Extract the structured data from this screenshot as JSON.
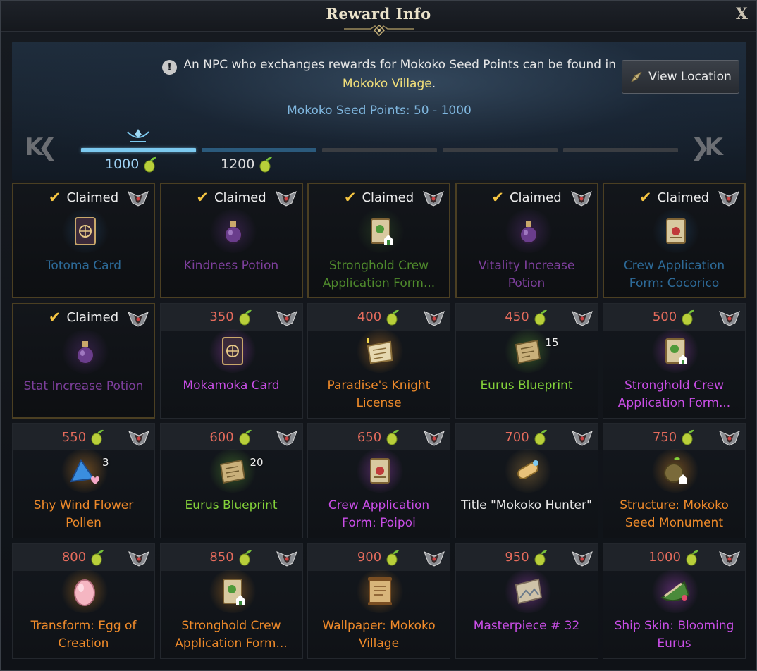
{
  "window": {
    "title": "Reward Info",
    "close_label": "X"
  },
  "header": {
    "notice_text": "An NPC who exchanges rewards for Mokoko Seed Points can be found in",
    "notice_place": "Mokoko Village",
    "notice_end": ".",
    "view_location_label": "View Location",
    "seed_range": "Mokoko Seed Points: 50 - 1000"
  },
  "progress": {
    "left_arrow": "K❮",
    "right_arrow": "❯K",
    "tier_labels": [
      "1000",
      "1200"
    ],
    "active_tier": 0
  },
  "rewards": [
    {
      "status": "Claimed",
      "name": "Totoma Card",
      "color": "dimblue",
      "icon": "card-icon"
    },
    {
      "status": "Claimed",
      "name": "Kindness Potion",
      "color": "dimpurple",
      "icon": "potion-icon"
    },
    {
      "status": "Claimed",
      "name": "Stronghold Crew Application Form...",
      "color": "dimgreen",
      "icon": "scroll-house-icon"
    },
    {
      "status": "Claimed",
      "name": "Vitality Increase Potion",
      "color": "dimpurple",
      "icon": "potion-icon"
    },
    {
      "status": "Claimed",
      "name": "Crew Application Form: Cocorico",
      "color": "dimblue",
      "icon": "scroll-icon"
    },
    {
      "status": "Claimed",
      "name": "Stat Increase Potion",
      "color": "dimpurple",
      "icon": "potion-icon"
    },
    {
      "cost": "350",
      "name": "Mokamoka Card",
      "color": "magenta",
      "icon": "card-icon"
    },
    {
      "cost": "400",
      "name": "Paradise's Knight License",
      "color": "orange",
      "icon": "license-icon"
    },
    {
      "cost": "450",
      "name": "Eurus Blueprint",
      "color": "lime",
      "icon": "blueprint-icon",
      "qty": "15"
    },
    {
      "cost": "500",
      "name": "Stronghold Crew Application Form...",
      "color": "magenta",
      "icon": "scroll-house-icon"
    },
    {
      "cost": "550",
      "name": "Shy Wind Flower Pollen",
      "color": "orange",
      "icon": "pollen-icon",
      "qty": "3"
    },
    {
      "cost": "600",
      "name": "Eurus Blueprint",
      "color": "lime",
      "icon": "blueprint-icon",
      "qty": "20"
    },
    {
      "cost": "650",
      "name": "Crew Application Form: Poipoi",
      "color": "magenta",
      "icon": "scroll-icon"
    },
    {
      "cost": "700",
      "name": "Title \"Mokoko Hunter\"",
      "color": "white",
      "icon": "title-scroll-icon"
    },
    {
      "cost": "750",
      "name": "Structure: Mokoko Seed Monument",
      "color": "orange",
      "icon": "monument-icon"
    },
    {
      "cost": "800",
      "name": "Transform: Egg of Creation",
      "color": "orange",
      "icon": "egg-icon"
    },
    {
      "cost": "850",
      "name": "Stronghold Crew Application Form...",
      "color": "orange",
      "icon": "scroll-house-icon"
    },
    {
      "cost": "900",
      "name": "Wallpaper: Mokoko Village",
      "color": "orange",
      "icon": "wallpaper-icon"
    },
    {
      "cost": "950",
      "name": "Masterpiece # 32",
      "color": "magenta",
      "icon": "painting-icon"
    },
    {
      "cost": "1000",
      "name": "Ship Skin: Blooming Eurus",
      "color": "magenta",
      "icon": "ship-skin-icon"
    }
  ],
  "colors": {
    "claimed_check": "#f5c542",
    "cost": "#e46b5c",
    "seed_points": "#7fb6de",
    "progress_fill": "#7cc9ef"
  }
}
